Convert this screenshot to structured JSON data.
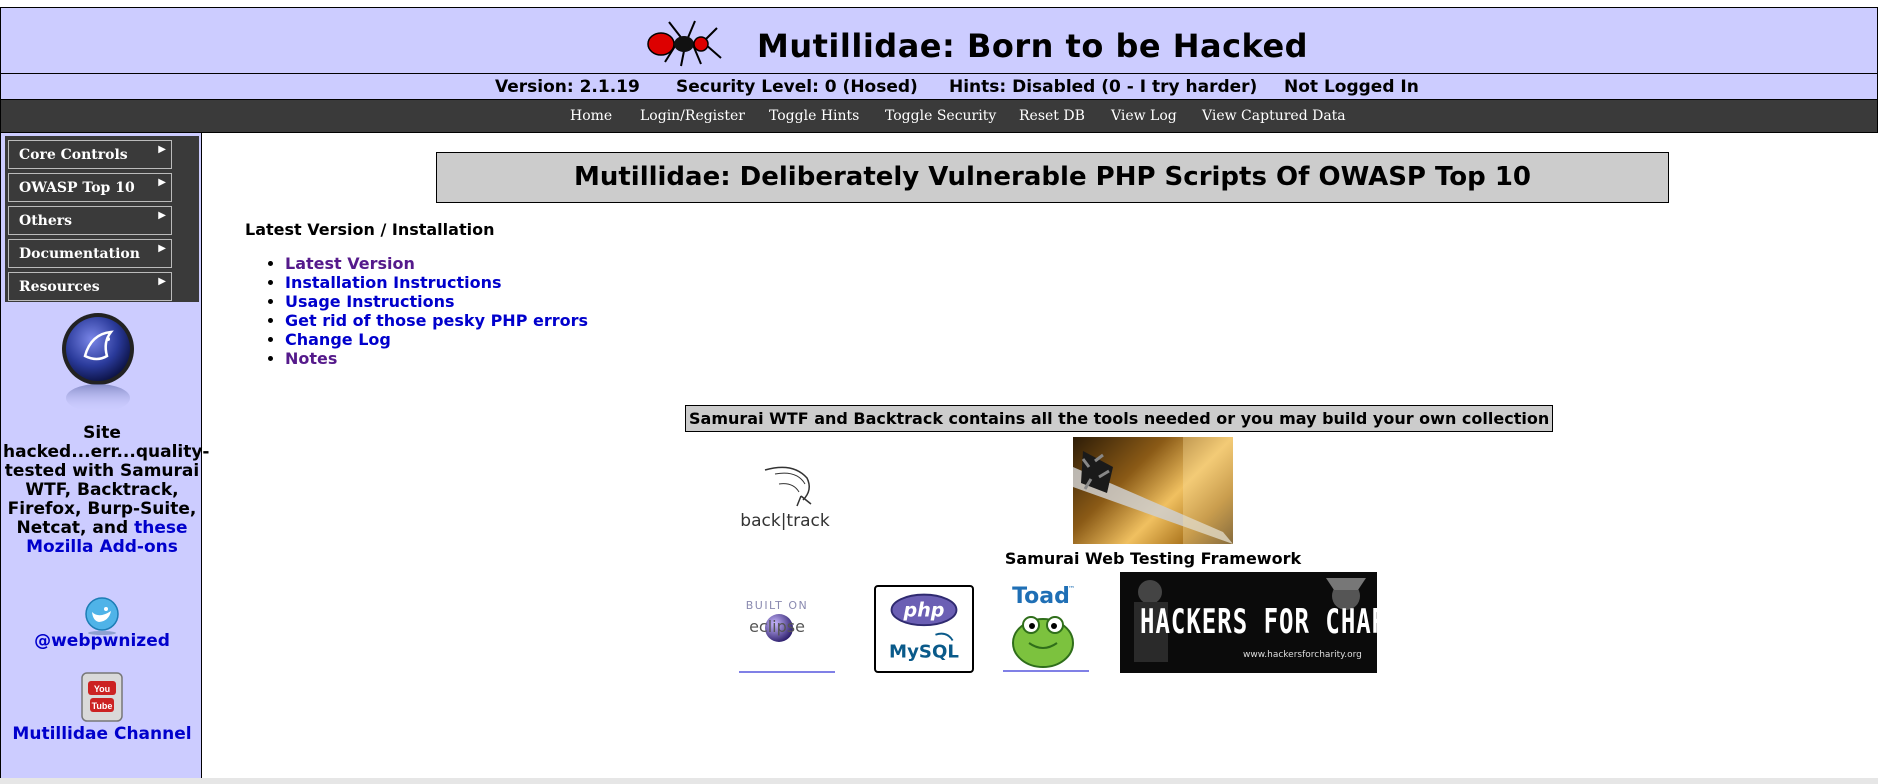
{
  "header": {
    "title": "Mutillidae: Born to be Hacked"
  },
  "status": {
    "version": "Version: 2.1.19",
    "security_level": "Security Level: 0 (Hosed)",
    "hints": "Hints: Disabled (0 - I try harder)",
    "login_state": "Not Logged In"
  },
  "nav": {
    "links": [
      "Home",
      "Login/Register",
      "Toggle Hints",
      "Toggle Security",
      "Reset DB",
      "View Log",
      "View Captured Data"
    ]
  },
  "sidebar": {
    "menu": [
      "Core Controls",
      "OWASP Top 10",
      "Others",
      "Documentation",
      "Resources"
    ],
    "note_text": "Site hacked...err...quality-tested with Samurai WTF, Backtrack, Firefox, Burp-Suite, Netcat, and",
    "note_link": "these Mozilla Add-ons",
    "twitter": "@webpwnized",
    "youtube": "Mutillidae Channel"
  },
  "main": {
    "heading": "Mutillidae: Deliberately Vulnerable PHP Scripts Of OWASP Top 10",
    "section_title": "Latest Version / Installation",
    "links": [
      "Latest Version",
      "Installation Instructions",
      "Usage Instructions",
      "Get rid of those pesky PHP errors",
      "Change Log",
      "Notes"
    ],
    "tools_note": "Samurai WTF and Backtrack contains all the tools needed or you may build your own collection",
    "samurai_caption": "Samurai Web Testing Framework",
    "logos": {
      "backtrack": "back|track",
      "eclipse_top": "BUILT ON",
      "eclipse_bottom": "eclipse",
      "php": "php",
      "mysql": "MySQL",
      "toad": "Toad",
      "toad_tm": "™",
      "hfc": "HACKERS FOR CHARITY",
      "hfc_url": "www.hackersforcharity.org"
    }
  },
  "colors": {
    "header_bg": "#ccccff",
    "nav_bg": "#3a3a3a",
    "link": "#0000cc",
    "visited_link": "#551a8b",
    "heading_bg": "#cccccc"
  }
}
